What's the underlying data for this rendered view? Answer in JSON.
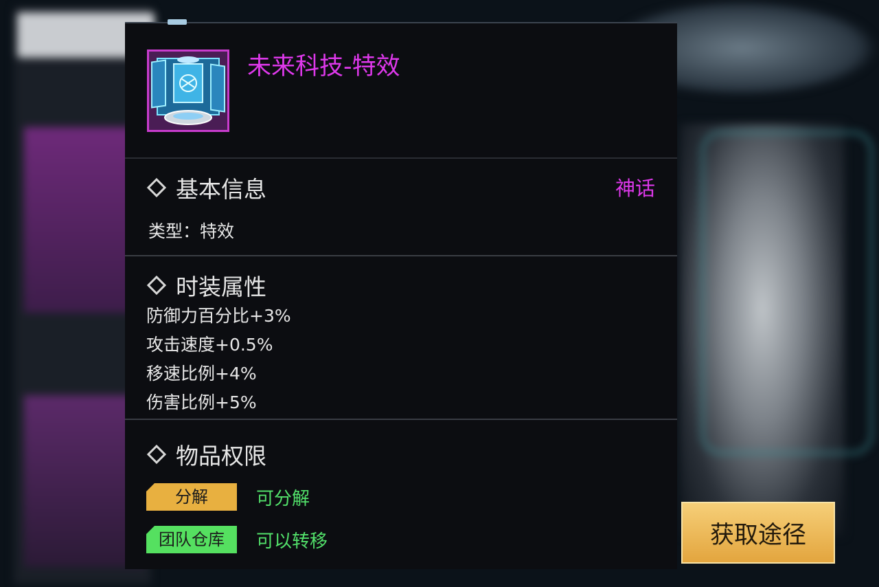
{
  "item": {
    "name": "未来科技-特效",
    "icon": "tech-portal-icon"
  },
  "basic_info": {
    "title": "基本信息",
    "rarity": "神话",
    "type_text": "类型：特效"
  },
  "attributes": {
    "title": "时装属性",
    "stats": [
      "防御力百分比+3%",
      "攻击速度+0.5%",
      "移速比例+4%",
      "伤害比例+5%"
    ]
  },
  "permissions": {
    "title": "物品权限",
    "rows": [
      {
        "label": "分解",
        "value": "可分解",
        "color": "#e8b040"
      },
      {
        "label": "团队仓库",
        "value": "可以转移",
        "color": "#55e060"
      }
    ]
  },
  "obtain_button": "获取途径",
  "colors": {
    "rarity": "#dd38ea",
    "positive": "#52e06a",
    "button": "#f0bc5c"
  }
}
